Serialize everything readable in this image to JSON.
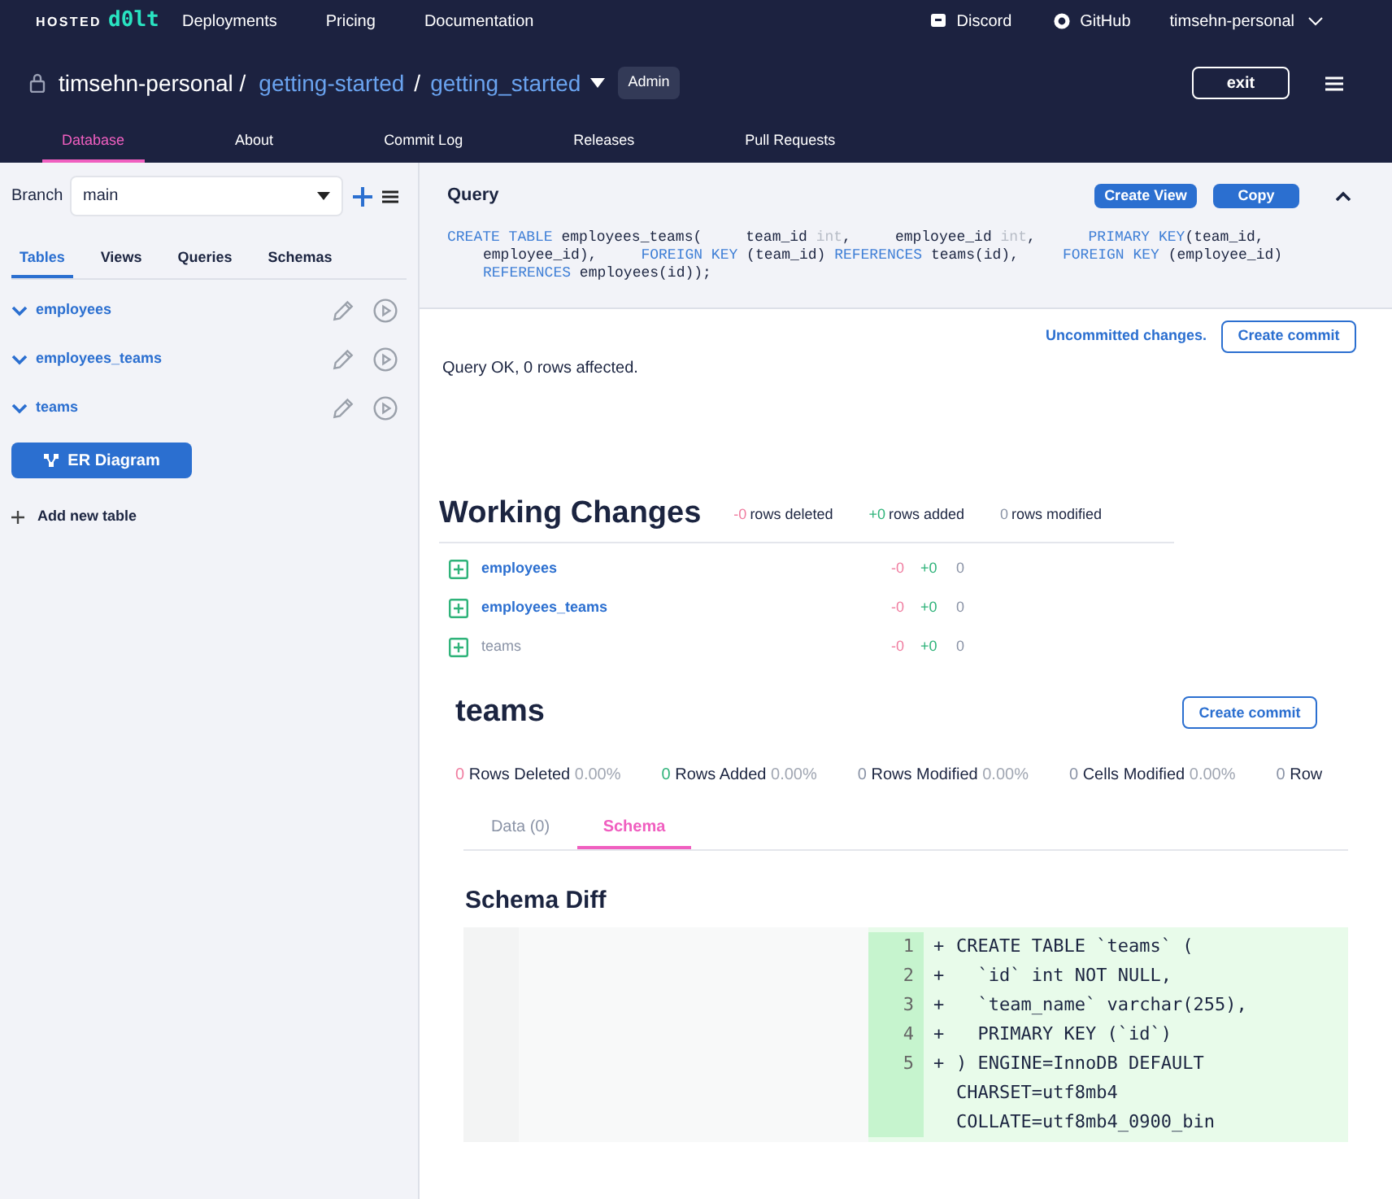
{
  "nav": {
    "logo_prefix": "HOSTED",
    "logo_brand": "d0lt",
    "links": [
      "Deployments",
      "Pricing",
      "Documentation"
    ],
    "discord": "Discord",
    "github": "GitHub",
    "user": "timsehn-personal"
  },
  "repo": {
    "owner": "timsehn-personal /",
    "database": "getting-started",
    "separator": "/",
    "branch_db": "getting_started",
    "role": "Admin",
    "exit": "exit"
  },
  "tabs": [
    {
      "label": "Database",
      "selected": true
    },
    {
      "label": "About",
      "selected": false
    },
    {
      "label": "Commit Log",
      "selected": false
    },
    {
      "label": "Releases",
      "selected": false
    },
    {
      "label": "Pull Requests",
      "selected": false
    }
  ],
  "sidebar": {
    "branch_label": "Branch",
    "branch": "main",
    "tabs": [
      {
        "label": "Tables",
        "selected": true
      },
      {
        "label": "Views",
        "selected": false
      },
      {
        "label": "Queries",
        "selected": false
      },
      {
        "label": "Schemas",
        "selected": false
      }
    ],
    "tables": [
      "employees",
      "employees_teams",
      "teams"
    ],
    "er_button": "ER Diagram",
    "add_table": "Add new table"
  },
  "query": {
    "title": "Query",
    "create_view": "Create View",
    "copy": "Copy",
    "lines": [
      {
        "tokens": [
          {
            "text": "CREATE TABLE",
            "kind": "keyword"
          },
          {
            "text": " employees_teams(     team_id ",
            "kind": "plain"
          },
          {
            "text": "int",
            "kind": "type"
          },
          {
            "text": ",     employee_id ",
            "kind": "plain"
          },
          {
            "text": "int",
            "kind": "type"
          },
          {
            "text": ",      ",
            "kind": "plain"
          },
          {
            "text": "PRIMARY KEY",
            "kind": "keyword"
          },
          {
            "text": "(team_id,",
            "kind": "plain"
          }
        ]
      },
      {
        "tokens": [
          {
            "text": "employee_id),     ",
            "kind": "plain"
          },
          {
            "text": "FOREIGN KEY",
            "kind": "keyword"
          },
          {
            "text": " (team_id) ",
            "kind": "plain"
          },
          {
            "text": "REFERENCES",
            "kind": "keyword"
          },
          {
            "text": " teams(id),     ",
            "kind": "plain"
          },
          {
            "text": "FOREIGN KEY",
            "kind": "keyword"
          },
          {
            "text": " (employee_id)",
            "kind": "plain"
          }
        ]
      },
      {
        "tokens": [
          {
            "text": "REFERENCES",
            "kind": "keyword"
          },
          {
            "text": " employees(id));",
            "kind": "plain"
          }
        ]
      }
    ],
    "uncommitted": "Uncommitted changes.",
    "create_commit": "Create commit",
    "result": "Query OK, 0 rows affected."
  },
  "working_changes": {
    "title": "Working Changes",
    "stats": [
      {
        "value": "-0",
        "label": "rows deleted",
        "kind": "deleted"
      },
      {
        "value": "+0",
        "label": "rows added",
        "kind": "added"
      },
      {
        "value": "0",
        "label": "rows modified",
        "kind": "modified"
      }
    ],
    "rows": [
      {
        "name": "employees",
        "selected": false,
        "deleted": "-0",
        "added": "+0",
        "modified": "0"
      },
      {
        "name": "employees_teams",
        "selected": false,
        "deleted": "-0",
        "added": "+0",
        "modified": "0"
      },
      {
        "name": "teams",
        "selected": true,
        "deleted": "-0",
        "added": "+0",
        "modified": "0"
      }
    ]
  },
  "table_diff": {
    "title": "teams",
    "create_commit": "Create commit",
    "summary": [
      {
        "value": "0",
        "label": "Rows Deleted",
        "percent": "0.00%",
        "kind": "deleted"
      },
      {
        "value": "0",
        "label": "Rows Added",
        "percent": "0.00%",
        "kind": "added"
      },
      {
        "value": "0",
        "label": "Rows Modified",
        "percent": "0.00%",
        "kind": "modified"
      },
      {
        "value": "0",
        "label": "Cells Modified",
        "percent": "0.00%",
        "kind": "modified"
      },
      {
        "value": "0",
        "label": "Row",
        "kind": "modified"
      }
    ],
    "tabs": [
      {
        "label": "Data (0)",
        "selected": false
      },
      {
        "label": "Schema",
        "selected": true
      }
    ],
    "schema_title": "Schema Diff",
    "diff_lines": [
      {
        "number": "1",
        "marker": "+",
        "text": "CREATE TABLE `teams` ("
      },
      {
        "number": "2",
        "marker": "+",
        "text": "  `id` int NOT NULL,"
      },
      {
        "number": "3",
        "marker": "+",
        "text": "  `team_name` varchar(255),"
      },
      {
        "number": "4",
        "marker": "+",
        "text": "  PRIMARY KEY (`id`)"
      },
      {
        "number": "5",
        "marker": "+",
        "text": ") ENGINE=InnoDB DEFAULT CHARSET=utf8mb4 COLLATE=utf8mb4_0900_bin"
      }
    ]
  }
}
